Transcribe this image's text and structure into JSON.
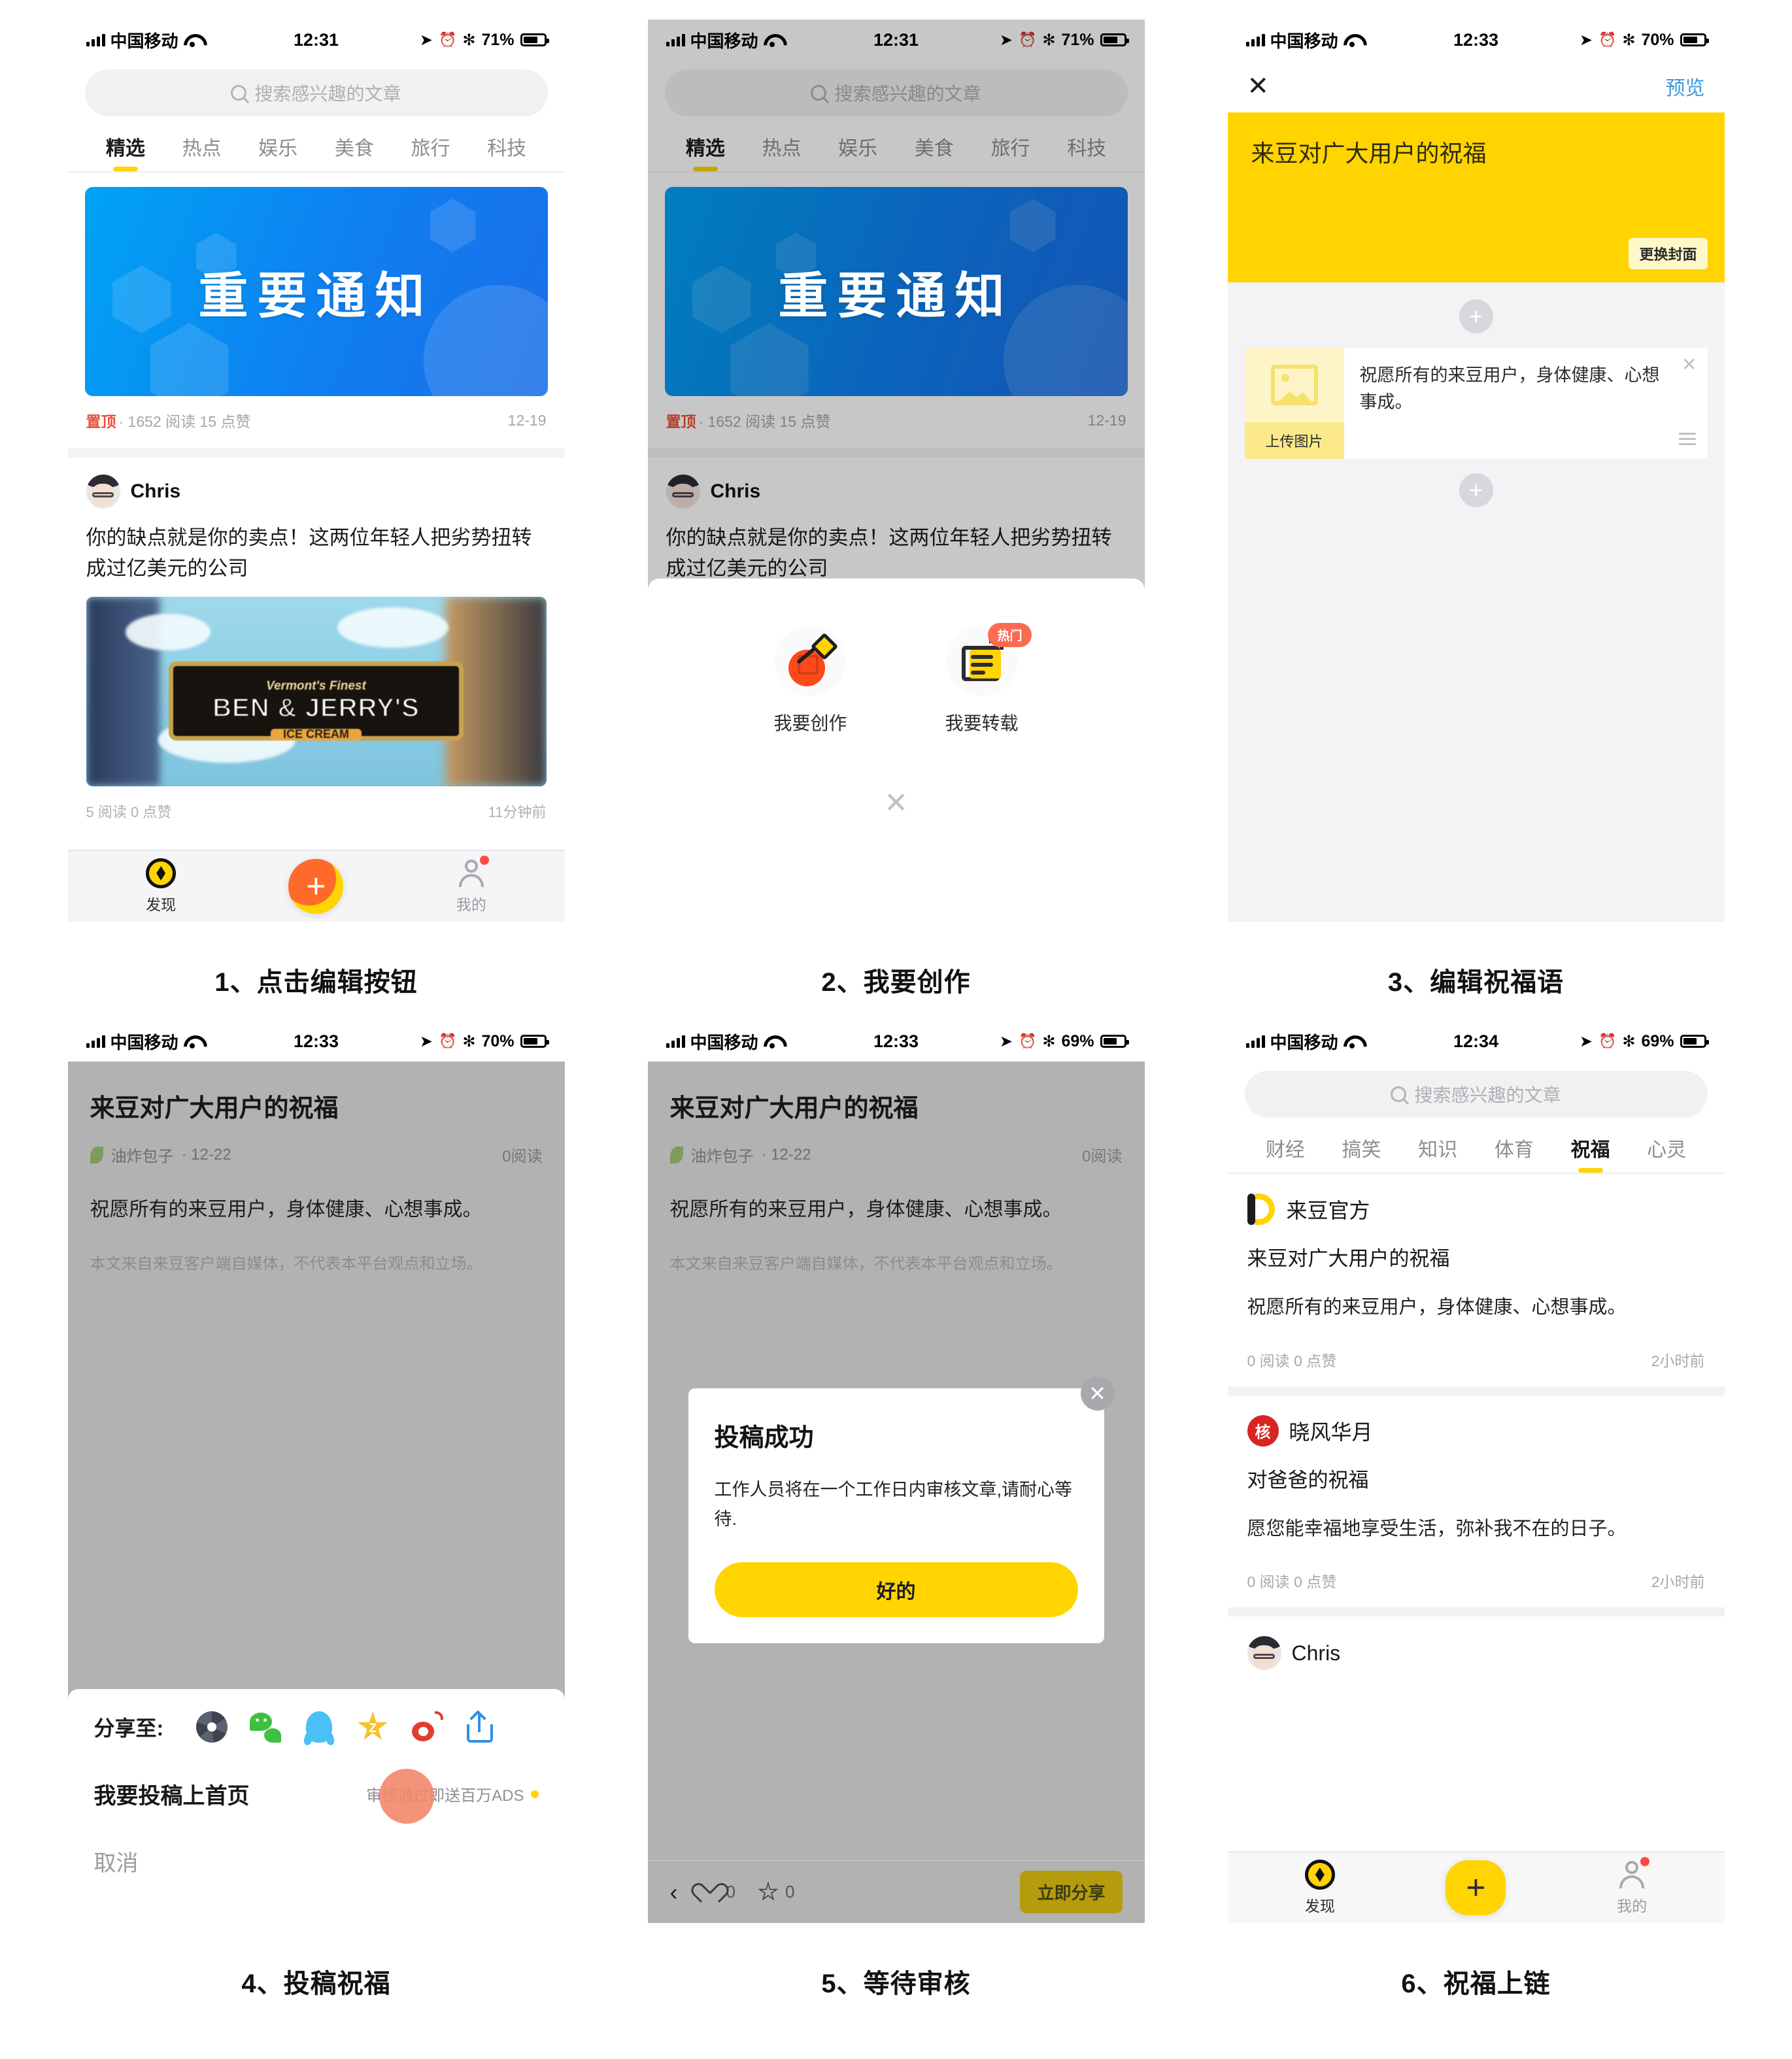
{
  "panels": [
    {
      "caption": "1、点击编辑按钮",
      "status": {
        "carrier": "中国移动",
        "time": "12:31",
        "battery": "71%"
      },
      "search_placeholder": "搜索感兴趣的文章",
      "tabs": [
        "精选",
        "热点",
        "娱乐",
        "美食",
        "旅行",
        "科技"
      ],
      "active_tab": "精选",
      "banner_text": "重要通知",
      "banner_pin": "置顶",
      "banner_meta": "· 1652 阅读  15 点赞",
      "banner_date": "12-19",
      "author": "Chris",
      "article_title": "你的缺点就是你的卖点！这两位年轻人把劣势扭转成过亿美元的公司",
      "image_alt_top": "Vermont's Finest",
      "image_alt_main": "BEN & JERRY'S",
      "image_alt_sub": "ICE CREAM",
      "article_stats": "5 阅读  0 点赞",
      "article_time": "11分钟前",
      "nav": {
        "discover": "发现",
        "mine": "我的",
        "plus": "+"
      }
    },
    {
      "caption": "2、我要创作",
      "status": {
        "carrier": "中国移动",
        "time": "12:31",
        "battery": "71%"
      },
      "search_placeholder": "搜索感兴趣的文章",
      "tabs": [
        "精选",
        "热点",
        "娱乐",
        "美食",
        "旅行",
        "科技"
      ],
      "active_tab": "精选",
      "banner_text": "重要通知",
      "banner_pin": "置顶",
      "banner_meta": "· 1652 阅读  15 点赞",
      "banner_date": "12-19",
      "author": "Chris",
      "article_title": "你的缺点就是你的卖点！这两位年轻人把劣势扭转成过亿美元的公司",
      "sheet": {
        "create_label": "我要创作",
        "repost_label": "我要转载",
        "hot_badge": "热门",
        "close": "✕"
      }
    },
    {
      "caption": "3、编辑祝福语",
      "status": {
        "carrier": "中国移动",
        "time": "12:33",
        "battery": "70%"
      },
      "close_label": "✕",
      "preview_label": "预览",
      "cover_title": "来豆对广大用户的祝福",
      "cover_change_btn": "更换封面",
      "add_symbol": "+",
      "upload_label": "上传图片",
      "block_text": "祝愿所有的来豆用户，身体健康、心想事成。"
    },
    {
      "caption": "4、投稿祝福",
      "status": {
        "carrier": "中国移动",
        "time": "12:33",
        "battery": "70%"
      },
      "title": "来豆对广大用户的祝福",
      "author": "油炸包子",
      "date": "· 12-22",
      "reads": "0阅读",
      "body": "祝愿所有的来豆用户，身体健康、心想事成。",
      "disclaimer": "本文来自来豆客户端自媒体，不代表本平台观点和立场。",
      "share": {
        "label": "分享至:",
        "icons": [
          "shutter-icon",
          "wechat-icon",
          "qq-icon",
          "qzone-star-icon",
          "weibo-icon",
          "share-upload-icon"
        ],
        "submit_title": "我要投稿上首页",
        "submit_hint": "审核通过即送百万ADS",
        "cancel": "取消"
      }
    },
    {
      "caption": "5、等待审核",
      "status": {
        "carrier": "中国移动",
        "time": "12:33",
        "battery": "69%"
      },
      "title": "来豆对广大用户的祝福",
      "author": "油炸包子",
      "date": "· 12-22",
      "reads": "0阅读",
      "body": "祝愿所有的来豆用户，身体健康、心想事成。",
      "disclaimer": "本文来自来豆客户端自媒体，不代表本平台观点和立场。",
      "dialog": {
        "title": "投稿成功",
        "message": "工作人员将在一个工作日内审核文章,请耐心等待.",
        "button": "好的",
        "close": "✕"
      },
      "bottombar": {
        "back": "‹",
        "like_count": "0",
        "fav_count": "0",
        "share_btn": "立即分享"
      }
    },
    {
      "caption": "6、祝福上链",
      "status": {
        "carrier": "中国移动",
        "time": "12:34",
        "battery": "69%"
      },
      "search_placeholder": "搜索感兴趣的文章",
      "tabs": [
        "财经",
        "搞笑",
        "知识",
        "体育",
        "祝福",
        "心灵"
      ],
      "active_tab": "祝福",
      "feed": [
        {
          "brand": "来豆官方",
          "title": "来豆对广大用户的祝福",
          "body": "祝愿所有的来豆用户，身体健康、心想事成。",
          "stats": "0 阅读  0 点赞",
          "time": "2小时前"
        },
        {
          "brand": "晓风华月",
          "seal": "核",
          "title": "对爸爸的祝福",
          "body": "愿您能幸福地享受生活，弥补我不在的日子。",
          "stats": "0 阅读  0 点赞",
          "time": "2小时前"
        },
        {
          "brand": "Chris"
        }
      ],
      "nav": {
        "discover": "发现",
        "mine": "我的",
        "plus": "+"
      }
    }
  ],
  "colors": {
    "brand_yellow": "#ffd400",
    "accent_orange": "#fc4a1a",
    "banner_blue": "#0f7ff0",
    "link_blue": "#3a9bdc",
    "badge_red": "#fd6a52"
  }
}
